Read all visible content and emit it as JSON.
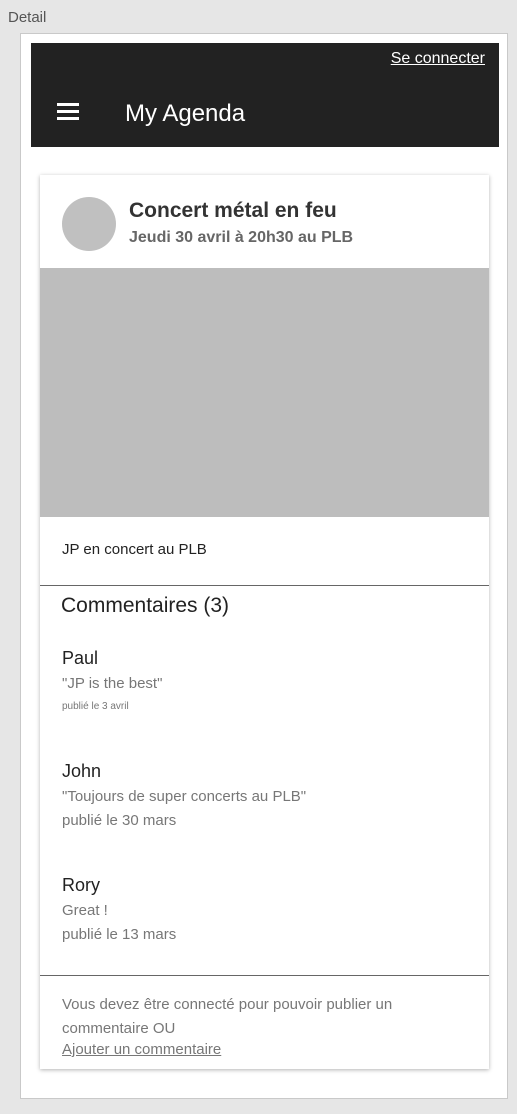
{
  "frame": {
    "label": "Detail"
  },
  "appbar": {
    "signin_label": "Se connecter",
    "title": "My Agenda",
    "background": "#222222"
  },
  "event": {
    "title": "Concert métal en feu",
    "subtitle": "Jeudi 30 avril à 20h30 au PLB",
    "description": "JP en concert au PLB"
  },
  "comments": {
    "heading": "Commentaires (3)",
    "items": [
      {
        "author": "Paul",
        "text": "\"JP is the best\"",
        "date": "publié le 3 avril"
      },
      {
        "author": "John",
        "text": "\"Toujours de super concerts au PLB\"",
        "date": "publié le 30 mars"
      },
      {
        "author": "Rory",
        "text": "Great !",
        "date": "publié le 13 mars"
      }
    ]
  },
  "footer": {
    "notice": "Vous devez être connecté pour pouvoir publier un commentaire OU",
    "add_comment_link": "Ajouter un commentaire"
  }
}
